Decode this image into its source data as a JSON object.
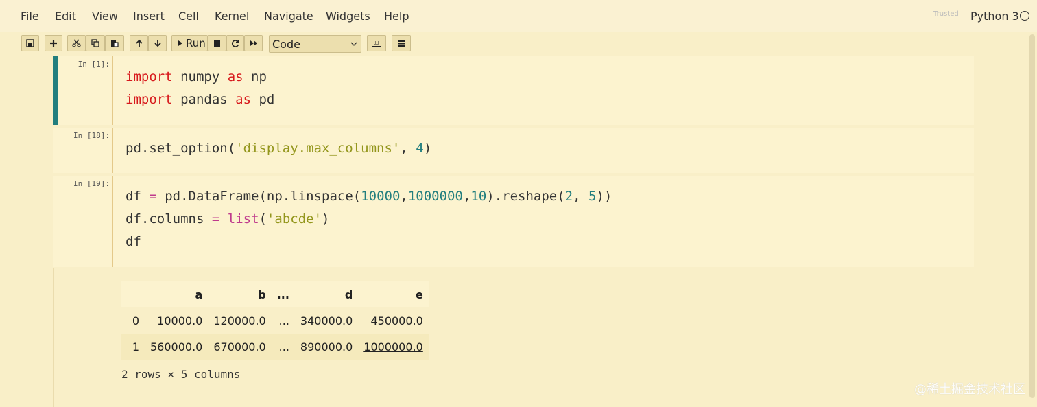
{
  "menu": [
    "File",
    "Edit",
    "View",
    "Insert",
    "Cell",
    "Kernel",
    "Navigate",
    "Widgets",
    "Help"
  ],
  "header": {
    "trusted": "Trusted",
    "kernel": "Python 3"
  },
  "toolbar": {
    "run_label": "Run",
    "cell_type": "Code"
  },
  "cells": [
    {
      "prompt": "In [1]:",
      "lines": [
        "import numpy as np",
        "import pandas as pd"
      ]
    },
    {
      "prompt": "In [18]:",
      "lines": [
        "pd.set_option('display.max_columns', 4)"
      ]
    },
    {
      "prompt": "In [19]:",
      "lines": [
        "df = pd.DataFrame(np.linspace(10000,1000000,10).reshape(2, 5))",
        "df.columns = list('abcde')",
        "df"
      ]
    }
  ],
  "output": {
    "columns": [
      "",
      "a",
      "b",
      "...",
      "d",
      "e"
    ],
    "rows": [
      [
        "0",
        "10000.0",
        "120000.0",
        "...",
        "340000.0",
        "450000.0"
      ],
      [
        "1",
        "560000.0",
        "670000.0",
        "...",
        "890000.0",
        "1000000.0"
      ]
    ],
    "shape_text": "2 rows × 5 columns"
  },
  "watermark": "@稀土掘金技术社区",
  "colors": {
    "background": "#f9efc8",
    "selected_border": "#227e7e",
    "keyword": "#d7191c",
    "string": "#93961c",
    "number": "#227e7e"
  }
}
